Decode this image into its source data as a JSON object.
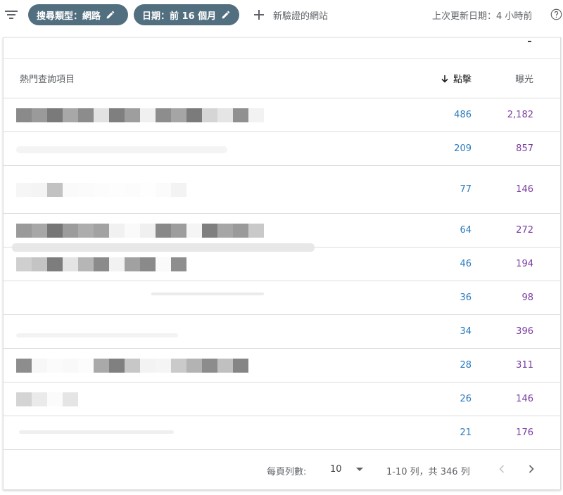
{
  "colors": {
    "chip_bg": "#526f80",
    "clicks": "#2a7bbf",
    "impressions": "#7a3da0"
  },
  "filters": [
    {
      "label": "搜尋類型：網路",
      "icon": "edit-icon"
    },
    {
      "label": "日期：前 16 個月",
      "icon": "edit-icon"
    }
  ],
  "add_verified": {
    "label": "新驗證的網站",
    "icon": "plus-icon"
  },
  "last_updated": "上次更新日期：4 小時前",
  "table": {
    "headers": {
      "query": "熱門查詢項目",
      "clicks": "點擊",
      "impressions": "曝光"
    },
    "sort": "clicks-desc",
    "rows": [
      {
        "clicks": "486",
        "impressions": "2,182"
      },
      {
        "clicks": "209",
        "impressions": "857"
      },
      {
        "clicks": "77",
        "impressions": "146"
      },
      {
        "clicks": "64",
        "impressions": "272"
      },
      {
        "clicks": "46",
        "impressions": "194"
      },
      {
        "clicks": "36",
        "impressions": "98"
      },
      {
        "clicks": "34",
        "impressions": "396"
      },
      {
        "clicks": "28",
        "impressions": "311"
      },
      {
        "clicks": "26",
        "impressions": "146"
      },
      {
        "clicks": "21",
        "impressions": "176"
      }
    ]
  },
  "pagination": {
    "rows_per_page_label": "每頁列數:",
    "rows_per_page": "10",
    "range": "1-10 列，共 346 列"
  }
}
